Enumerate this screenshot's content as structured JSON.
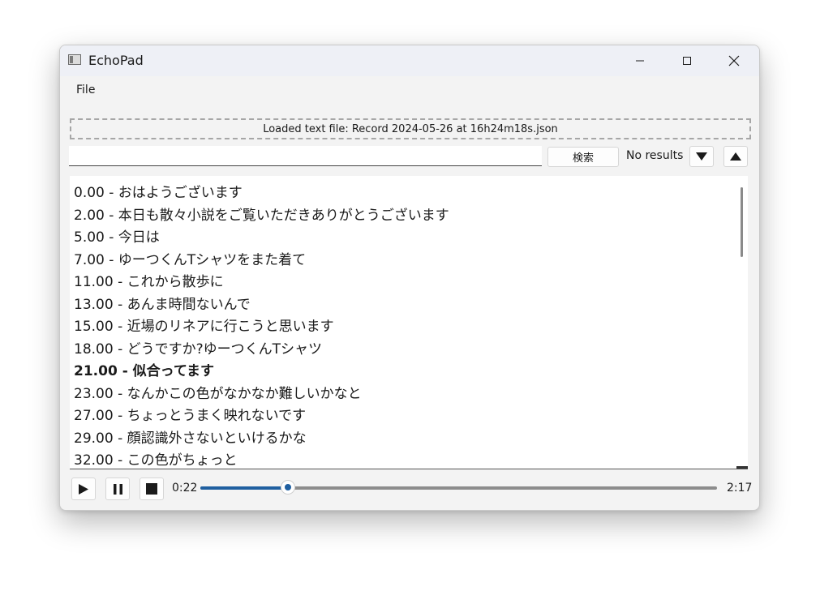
{
  "window": {
    "title": "EchoPad",
    "accent_color": "#1f5fa0"
  },
  "menu": {
    "file_label": "File"
  },
  "status": {
    "loaded_text": "Loaded text file: Record 2024-05-26 at 16h24m18s.json"
  },
  "search": {
    "value": "",
    "button_label": "検索",
    "results_label": "No results"
  },
  "transcript": {
    "lines": [
      {
        "text": "0.00 - おはようございます",
        "bold": false
      },
      {
        "text": "2.00 - 本日も散々小説をご覧いただきありがとうございます",
        "bold": false
      },
      {
        "text": "5.00 - 今日は",
        "bold": false
      },
      {
        "text": "7.00 - ゆーつくんTシャツをまた着て",
        "bold": false
      },
      {
        "text": "11.00 - これから散歩に",
        "bold": false
      },
      {
        "text": "13.00 - あんま時間ないんで",
        "bold": false
      },
      {
        "text": "15.00 - 近場のリネアに行こうと思います",
        "bold": false
      },
      {
        "text": "18.00 - どうですか?ゆーつくんTシャツ",
        "bold": false
      },
      {
        "text": "21.00 - 似合ってます",
        "bold": true
      },
      {
        "text": "23.00 - なんかこの色がなかなか難しいかなと",
        "bold": false
      },
      {
        "text": "27.00 - ちょっとうまく映れないです",
        "bold": false
      },
      {
        "text": "29.00 - 顔認識外さないといけるかな",
        "bold": false
      },
      {
        "text": "32.00 - この色がちょっと",
        "bold": false
      }
    ]
  },
  "player": {
    "current_time": "0:22",
    "total_time": "2:17",
    "progress": 0.17
  }
}
